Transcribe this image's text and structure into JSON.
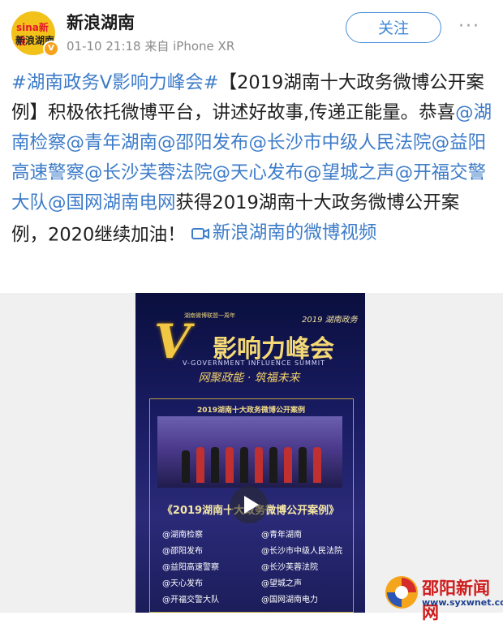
{
  "post": {
    "author": "新浪湖南",
    "avatar_logo_top": "sina新浪",
    "avatar_logo_bottom": "新浪湖南",
    "verified_badge": "V",
    "timestamp": "01-10 21:18",
    "source": "来自 iPhone XR",
    "follow_label": "关注",
    "more_icon": "···",
    "text": {
      "hashtag": "#湖南政务V影响力峰会#",
      "part1": "【2019湖南十大政务微博公开案例】积极依托微博平台，讲述好故事,传递正能量。恭喜",
      "mentions": [
        "@湖南检察",
        "@青年湖南",
        "@邵阳发布",
        "@长沙市中级人民法院",
        "@益阳高速警察",
        "@长沙芙蓉法院",
        "@天心发布",
        "@望城之声",
        "@开福交警大队",
        "@国网湖南电网"
      ],
      "part2": "获得2019湖南十大政务微博公开案例，2020继续加油！",
      "video_link": "新浪湖南的微博视频"
    }
  },
  "video": {
    "subtitle_tag": "湖南微博联盟一周年",
    "year_tag": "2019 湖南政务",
    "big_v": "V",
    "summit_title": "影响力峰会",
    "english": "V-GOVERNMENT INFLUENCE SUMMIT",
    "slogan": "网聚政能 · 筑福未来",
    "frame_title": "2019湖南十大政务微博公开案例",
    "list_title": "《2019湖南十大政务微博公开案例》",
    "list_items": [
      "@湖南检察",
      "@青年湖南",
      "@邵阳发布",
      "@长沙市中级人民法院",
      "@益阳高速警察",
      "@长沙芙蓉法院",
      "@天心发布",
      "@望城之声",
      "@开福交警大队",
      "@国网湖南电力"
    ]
  },
  "watermark": {
    "name": "邵阳新闻网",
    "url": "www.syxwnet.com"
  },
  "colors": {
    "link": "#3d7cc9",
    "follow": "#3f86d6",
    "video_bg": "#1a1c63",
    "gold": "#f2c744",
    "watermark_red": "#cf1b1b"
  }
}
